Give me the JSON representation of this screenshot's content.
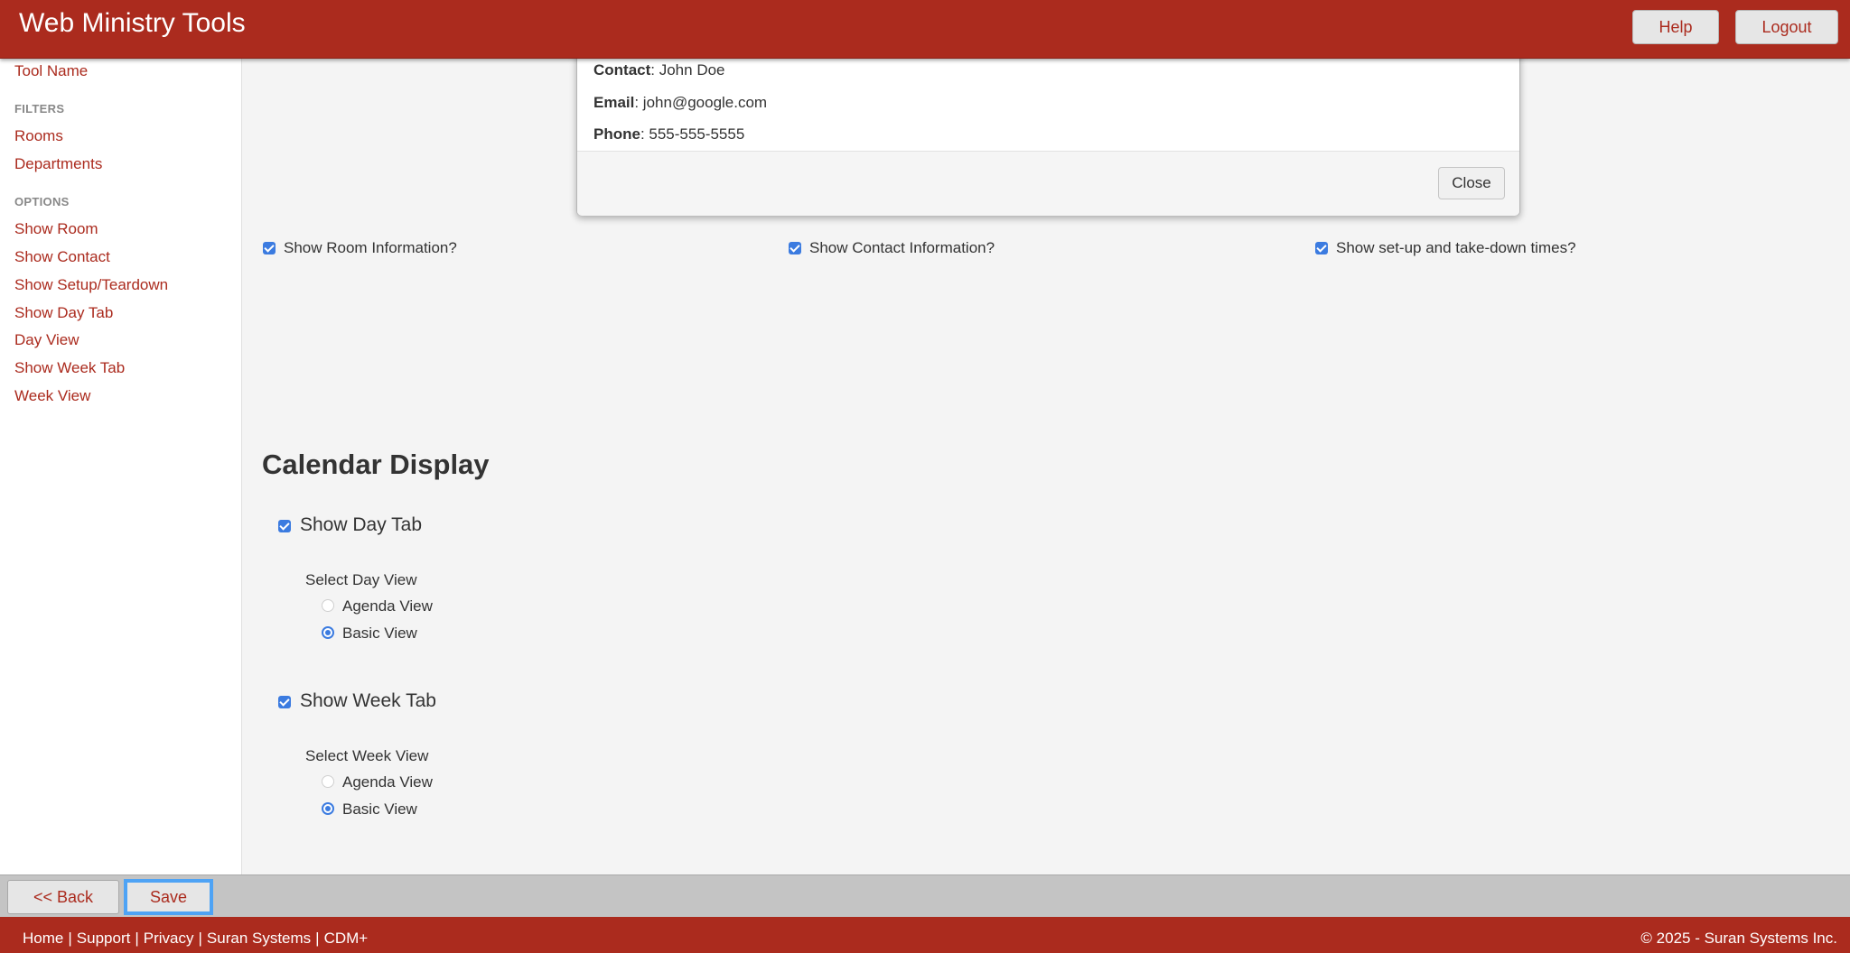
{
  "header": {
    "title": "Web Ministry Tools",
    "help_label": "Help",
    "logout_label": "Logout"
  },
  "sidebar": {
    "tool_name": "Tool Name",
    "filters_heading": "FILTERS",
    "filters": [
      "Rooms",
      "Departments"
    ],
    "options_heading": "OPTIONS",
    "options": [
      "Show Room",
      "Show Contact",
      "Show Setup/Teardown",
      "Show Day Tab",
      "Day View",
      "Show Week Tab",
      "Week View"
    ]
  },
  "modal": {
    "contact_label": "Contact",
    "contact_value": ": John Doe",
    "email_label": "Email",
    "email_value": ": john@google.com",
    "phone_label": "Phone",
    "phone_value": ": 555-555-5555",
    "close_label": "Close"
  },
  "options": {
    "room_info": {
      "label": "Show Room Information?",
      "checked": true
    },
    "contact_info": {
      "label": "Show Contact Information?",
      "checked": true
    },
    "setup_times": {
      "label": "Show set-up and take-down times?",
      "checked": true
    }
  },
  "calendar": {
    "title": "Calendar Display",
    "day_tab": {
      "label": "Show Day Tab",
      "checked": true,
      "select_label": "Select Day View",
      "views": [
        "Agenda View",
        "Basic View"
      ],
      "selected": "Basic View"
    },
    "week_tab": {
      "label": "Show Week Tab",
      "checked": true,
      "select_label": "Select Week View",
      "views": [
        "Agenda View",
        "Basic View"
      ],
      "selected": "Basic View"
    }
  },
  "actions": {
    "back_label": "<< Back",
    "save_label": "Save"
  },
  "footer": {
    "links": [
      "Home",
      "Support",
      "Privacy",
      "Suran Systems",
      "CDM+"
    ],
    "separator": "|",
    "copyright": "© 2025 - Suran Systems Inc."
  },
  "colors": {
    "brand": "#ab2b1e",
    "accent": "#3b7be0",
    "focus": "#4ea3f5"
  }
}
